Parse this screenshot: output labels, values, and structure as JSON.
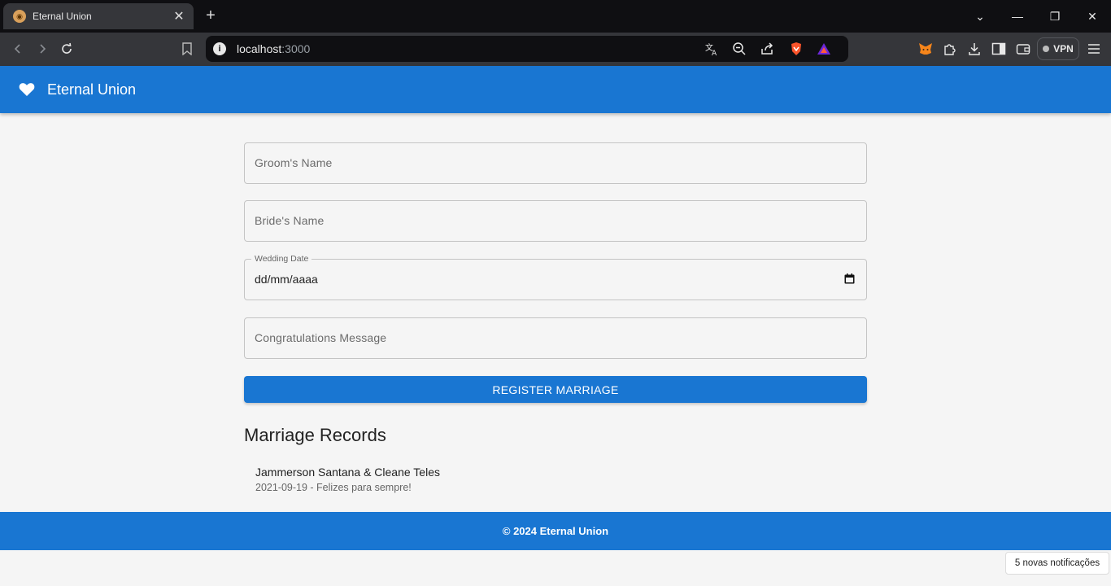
{
  "browser": {
    "tab_title": "Eternal Union",
    "url_host": "localhost",
    "url_port": ":3000",
    "vpn_label": "VPN"
  },
  "app": {
    "title": "Eternal Union",
    "accent_color": "#1976d2"
  },
  "form": {
    "groom_placeholder": "Groom's Name",
    "bride_placeholder": "Bride's Name",
    "date_label": "Wedding Date",
    "date_value": "dd/mm/aaaa",
    "message_placeholder": "Congratulations Message",
    "submit_label": "REGISTER MARRIAGE"
  },
  "records": {
    "heading": "Marriage Records",
    "items": [
      {
        "names": "Jammerson Santana & Cleane Teles",
        "detail": "2021-09-19 - Felizes para sempre!"
      }
    ]
  },
  "footer": {
    "text": "© 2024 Eternal Union"
  },
  "notification": {
    "text": "5 novas notificações"
  }
}
